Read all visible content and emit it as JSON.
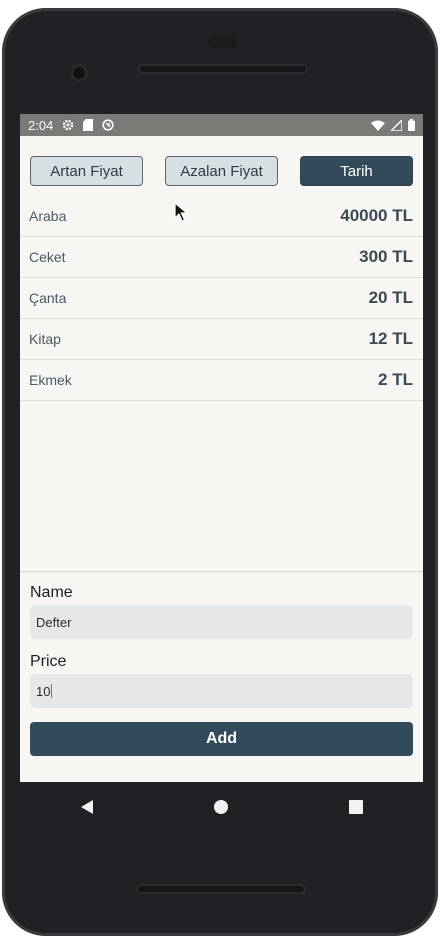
{
  "status_bar": {
    "time": "2:04",
    "icons_left": [
      "gear-icon",
      "sd-card-icon",
      "sync-icon"
    ],
    "icons_right": [
      "wifi-icon",
      "signal-icon",
      "battery-icon"
    ]
  },
  "sort_buttons": [
    {
      "label": "Artan Fiyat",
      "active": false
    },
    {
      "label": "Azalan Fiyat",
      "active": false
    },
    {
      "label": "Tarih",
      "active": true
    }
  ],
  "items": [
    {
      "name": "Araba",
      "price": "40000 TL"
    },
    {
      "name": "Ceket",
      "price": "300 TL"
    },
    {
      "name": "Çanta",
      "price": "20 TL"
    },
    {
      "name": "Kitap",
      "price": "12 TL"
    },
    {
      "name": "Ekmek",
      "price": "2 TL"
    }
  ],
  "form": {
    "name_label": "Name",
    "name_value": "Defter",
    "price_label": "Price",
    "price_value": "10",
    "add_label": "Add"
  },
  "colors": {
    "primary": "#324b5a",
    "screen_bg": "#f7f6f2",
    "status_bar": "#7a7a76"
  }
}
